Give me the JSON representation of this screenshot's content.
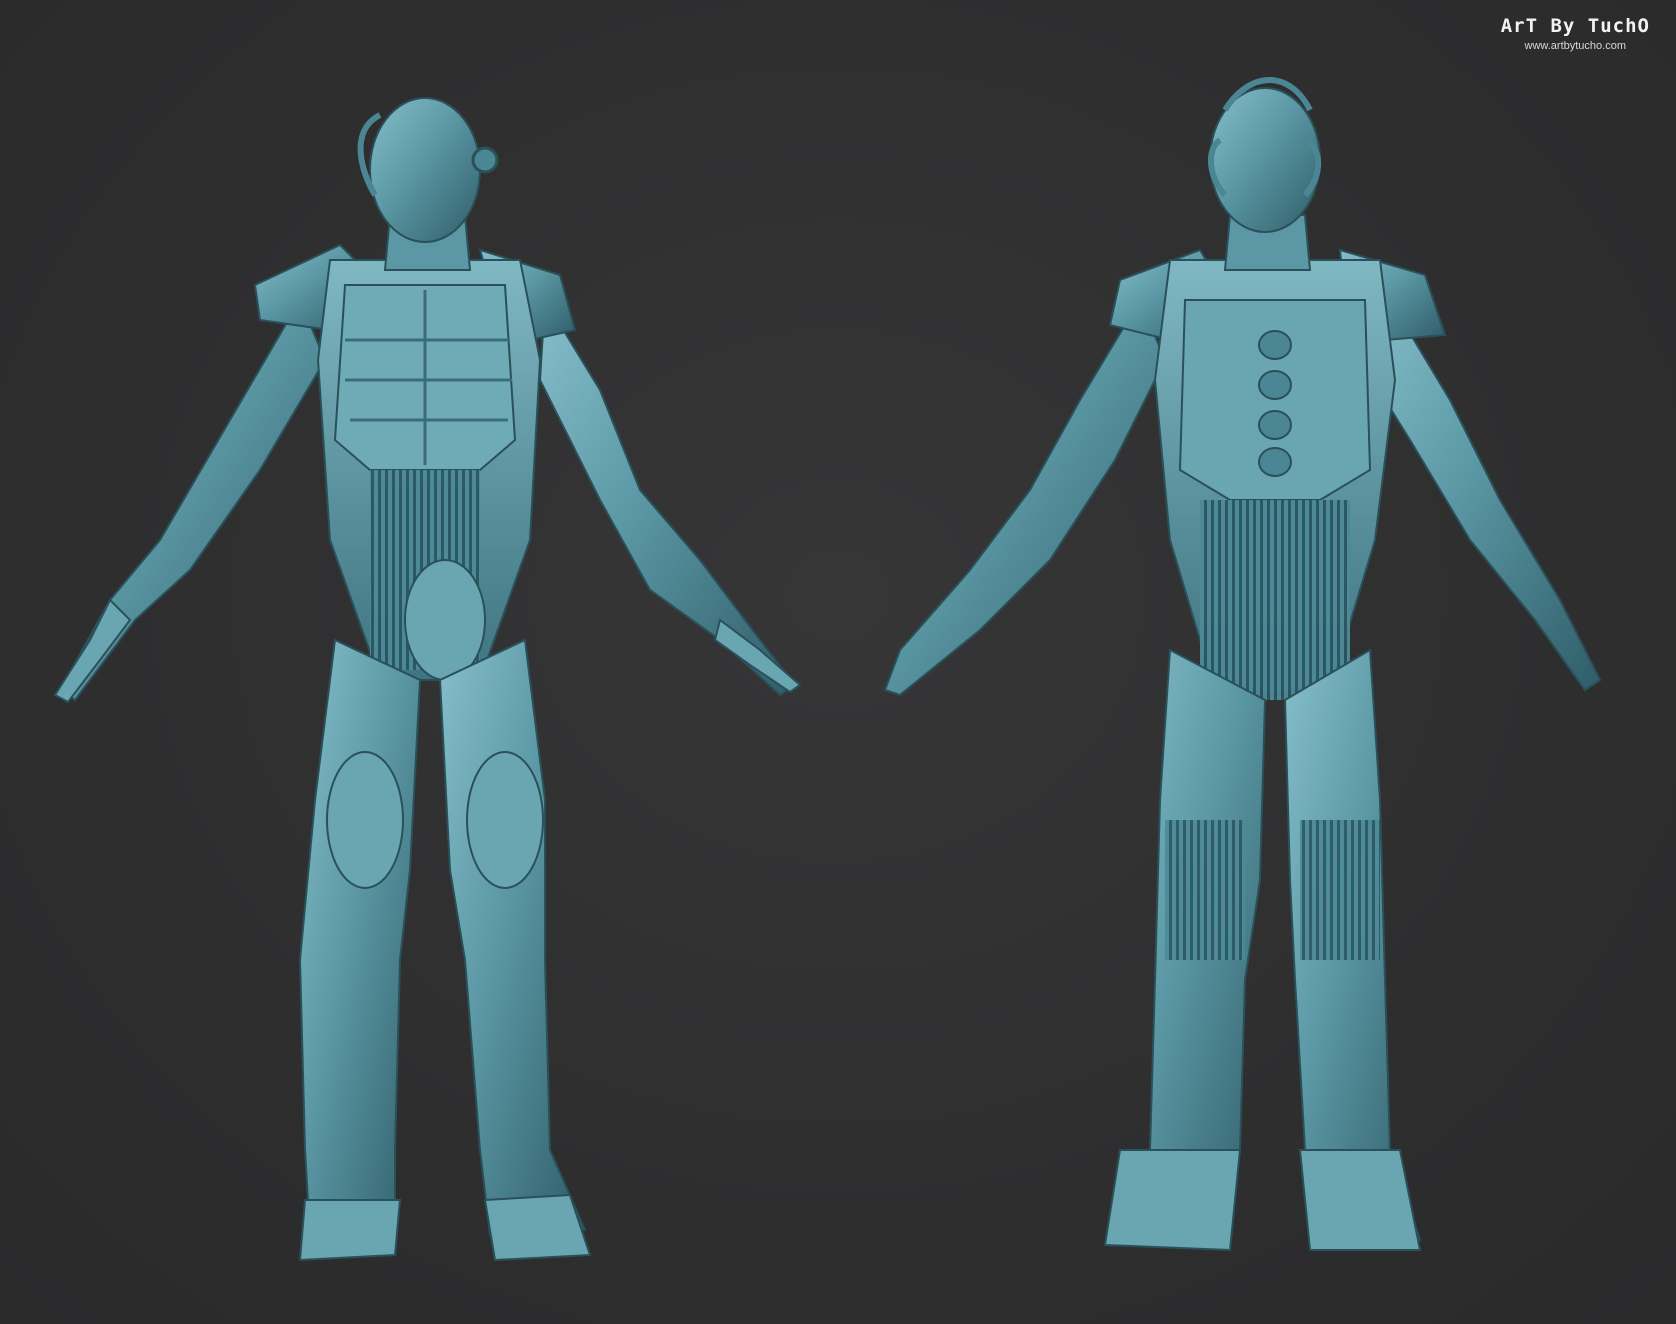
{
  "scene": {
    "background_color": "#2f2f30",
    "model_color": "#5b97a4",
    "model_shadow": "#2f5d68",
    "model_highlight": "#86bfcb",
    "views": [
      {
        "id": "front",
        "label_icon": "character-front-view"
      },
      {
        "id": "back",
        "label_icon": "character-back-view"
      }
    ]
  },
  "watermark": {
    "logo_text": "ArT By TuchO",
    "url": "www.artbytucho.com"
  }
}
